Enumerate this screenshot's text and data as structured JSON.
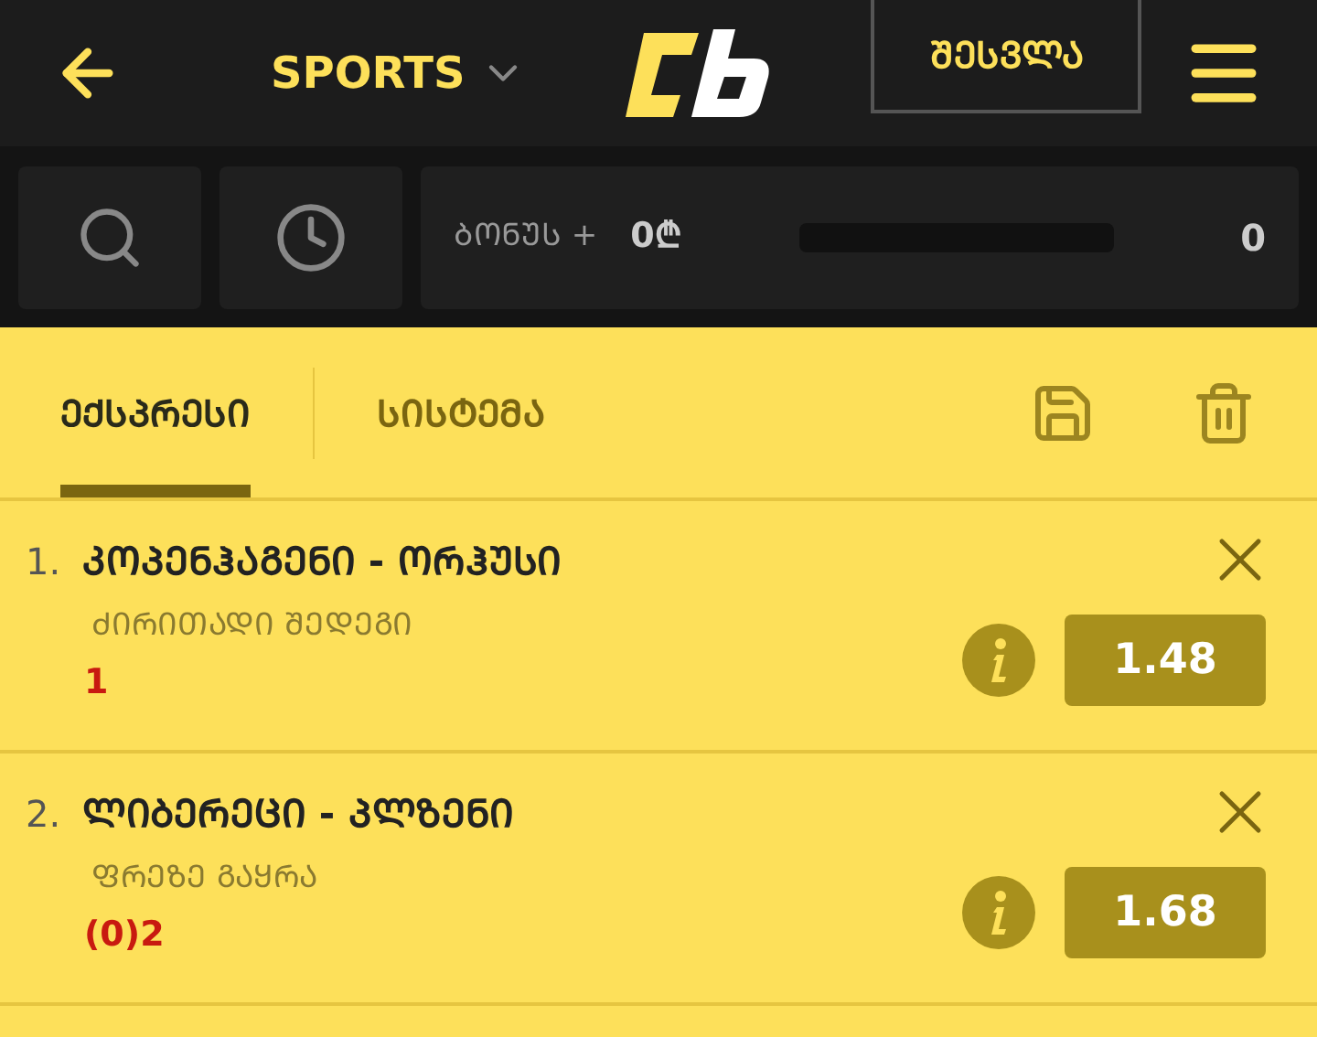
{
  "header": {
    "sport_menu": "SPORTS",
    "login_button": "ᲨᲔᲡᲕᲚᲐ"
  },
  "toolbar": {
    "bonus_label": "ᲑᲝᲜᲣᲡ +",
    "bonus_amount": "0₾",
    "bonus_progress": {
      "level": 0
    },
    "bonus_count": "0"
  },
  "tabs": [
    {
      "label": "ᲔᲥᲡᲞᲠᲔᲡᲘ",
      "selected": true
    },
    {
      "label": "ᲡᲘᲡᲢᲔᲛᲐ",
      "selected": false
    }
  ],
  "bets": [
    {
      "number": "1.",
      "match": "ᲙᲝᲞᲔᲜᲰᲐᲒᲔᲜᲘ - ᲝᲠᲰᲣᲡᲘ",
      "market": "ᲫᲘᲠᲘᲗᲐᲓᲘ ᲨᲔᲓᲔᲒᲘ",
      "pick": "1",
      "odds": "1.48"
    },
    {
      "number": "2.",
      "match": "ᲚᲘᲑᲔᲠᲔᲪᲘ - ᲞᲚᲖᲔᲜᲘ",
      "market": "ᲤᲠᲔᲖᲔ ᲒᲐᲧᲠᲐ",
      "pick": "(0)2",
      "odds": "1.68"
    }
  ]
}
